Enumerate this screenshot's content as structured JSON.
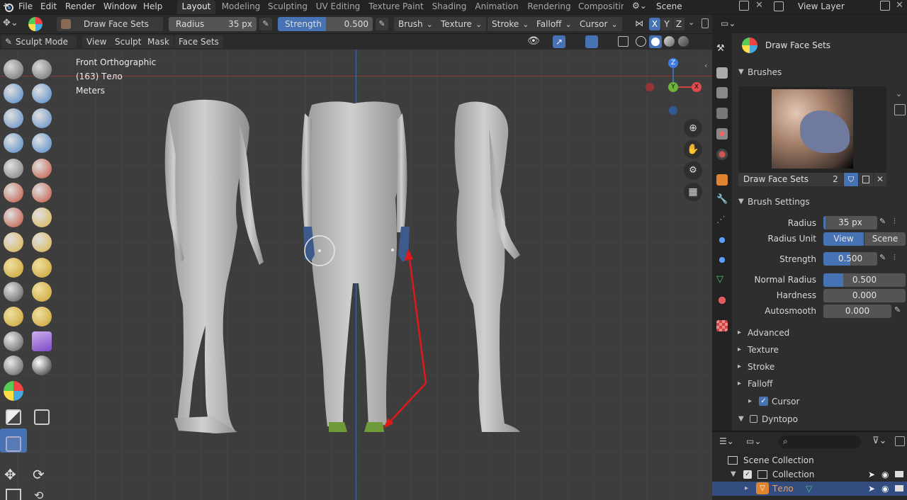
{
  "topbar": {
    "menus": [
      "File",
      "Edit",
      "Render",
      "Window",
      "Help"
    ],
    "workspaces": [
      "Layout",
      "Modeling",
      "Sculpting",
      "UV Editing",
      "Texture Paint",
      "Shading",
      "Animation",
      "Rendering",
      "Compositin"
    ],
    "active_workspace": "Layout",
    "scene_label": "Scene",
    "view_layer_label": "View Layer"
  },
  "header": {
    "brush_name": "Draw Face Sets",
    "radius_label": "Radius",
    "radius_value": "35 px",
    "strength_label": "Strength",
    "strength_value": "0.500",
    "dropdowns": [
      "Brush",
      "Texture",
      "Stroke",
      "Falloff",
      "Cursor"
    ],
    "axis_x": "X",
    "axis_y": "Y",
    "axis_z": "Z"
  },
  "modebar": {
    "mode": "Sculpt Mode",
    "menus": [
      "View",
      "Sculpt",
      "Mask",
      "Face Sets"
    ]
  },
  "viewport": {
    "view_name": "Front Orthographic",
    "object_info": "(163) Тело",
    "units": "Meters",
    "gizmo": {
      "x": "X",
      "y": "Y",
      "z": "Z"
    }
  },
  "properties": {
    "brush_title": "Draw Face Sets",
    "brushes_panel": "Brushes",
    "brush_slot_name": "Draw Face Sets",
    "brush_users": "2",
    "brush_settings_panel": "Brush Settings",
    "radius_label": "Radius",
    "radius_value": "35 px",
    "radius_unit_label": "Radius Unit",
    "radius_unit_options": [
      "View",
      "Scene"
    ],
    "radius_unit_selected": "View",
    "strength_label": "Strength",
    "strength_value": "0.500",
    "strength_fraction": 0.5,
    "normal_radius_label": "Normal Radius",
    "normal_radius_value": "0.500",
    "normal_radius_fraction": 0.5,
    "hardness_label": "Hardness",
    "hardness_value": "0.000",
    "autosmooth_label": "Autosmooth",
    "autosmooth_value": "0.000",
    "subpanels": [
      "Advanced",
      "Texture",
      "Stroke",
      "Falloff"
    ],
    "cursor_label": "Cursor",
    "cursor_checked": true,
    "dyntopo_label": "Dyntopo",
    "dyntopo_checked": false
  },
  "outliner": {
    "scene_collection": "Scene Collection",
    "collection": "Collection",
    "object": "Тело"
  },
  "colors": {
    "accent_blue": "#4772b3",
    "face_set_blue": "#3c5a8c",
    "face_set_green": "#6f9a3a",
    "annotation_red": "#e01818"
  }
}
